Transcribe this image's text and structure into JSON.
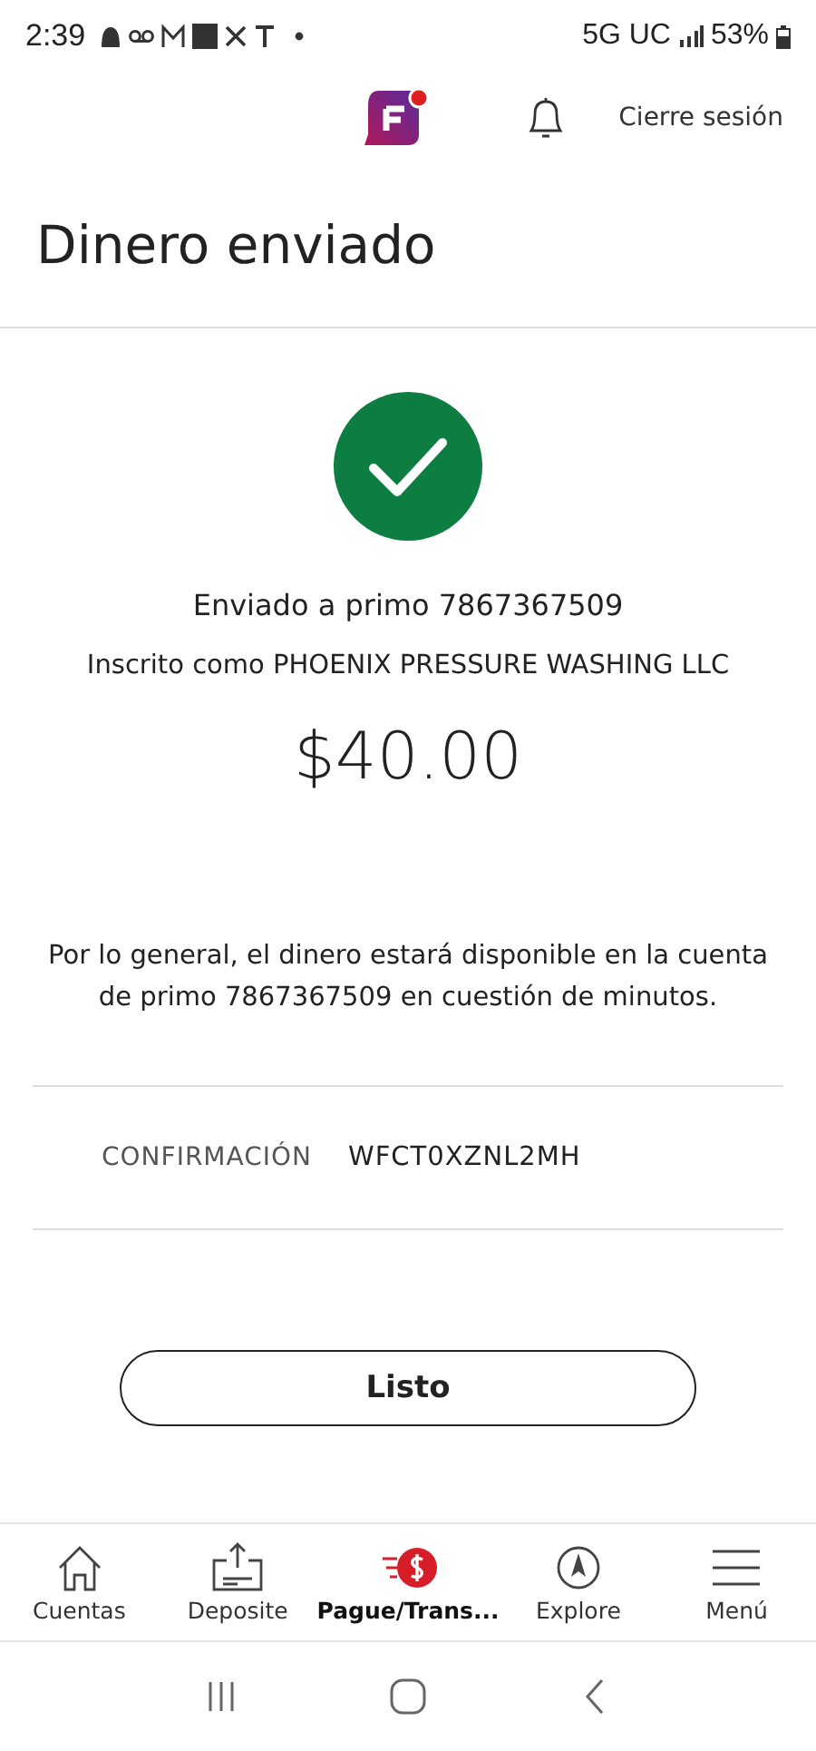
{
  "status_bar": {
    "time": "2:39",
    "network": "5G UC",
    "battery": "53%"
  },
  "header": {
    "logout": "Cierre sesión"
  },
  "title": "Dinero enviado",
  "result": {
    "sent_to": "Enviado a primo 7867367509",
    "enrolled_as": "Inscrito como PHOENIX PRESSURE WASHING LLC",
    "amount": "$40.00",
    "note": "Por lo general, el dinero estará disponible en la cuenta de primo 7867367509 en cuestión de minutos."
  },
  "confirmation": {
    "label": "CONFIRMACIÓN",
    "value": "WFCT0XZNL2MH"
  },
  "done_button": "Listo",
  "bottom_nav": [
    {
      "kind": "home",
      "label": "Cuentas",
      "selected": false
    },
    {
      "kind": "deposit",
      "label": "Deposite",
      "selected": false
    },
    {
      "kind": "pay",
      "label": "Pague/Trans...",
      "selected": true
    },
    {
      "kind": "explore",
      "label": "Explore",
      "selected": false
    },
    {
      "kind": "menu",
      "label": "Menú",
      "selected": false
    }
  ]
}
